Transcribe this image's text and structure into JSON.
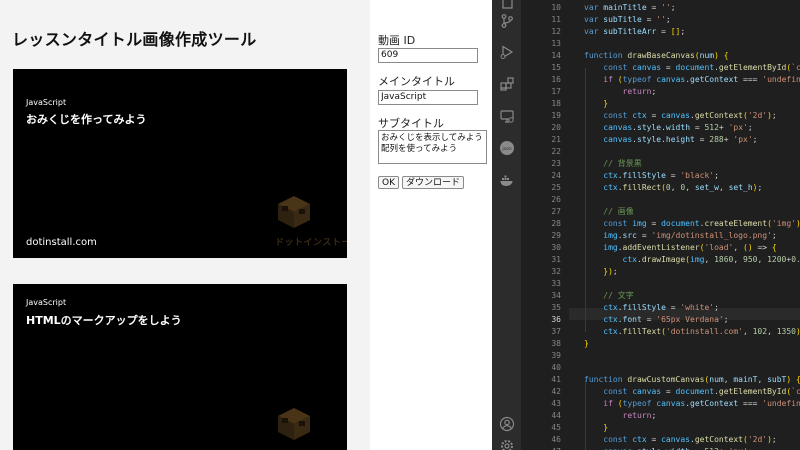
{
  "app": {
    "title": "レッスンタイトル画像作成ツール",
    "canvases": [
      {
        "lang": "JavaScript",
        "main": "おみくじを作ってみよう",
        "site": "dotinstall.com",
        "logo_text": "ドットインストール"
      },
      {
        "lang": "JavaScript",
        "main": "HTMLのマークアップをしよう",
        "site": "",
        "logo_text": ""
      }
    ]
  },
  "form": {
    "video_id_label": "動画 ID",
    "video_id_value": "609",
    "main_title_label": "メインタイトル",
    "main_title_value": "JavaScript",
    "sub_title_label": "サブタイトル",
    "sub_title_lines": [
      "おみくじを表示してみよう",
      "配列を使ってみよう"
    ],
    "ok_label": "OK",
    "download_label": "ダウンロード"
  },
  "editor": {
    "active_line": 36,
    "line_numbers": [
      10,
      11,
      12,
      13,
      14,
      15,
      16,
      17,
      18,
      19,
      20,
      21,
      22,
      23,
      24,
      25,
      26,
      27,
      28,
      29,
      30,
      31,
      32,
      33,
      34,
      35,
      36,
      37,
      38,
      39,
      40,
      41,
      42,
      43,
      44,
      45,
      46,
      47
    ],
    "line_texts": [
      "var mainTitle = '';",
      "var subTitle = '';",
      "var subTitleArr = [];",
      "",
      "function drawBaseCanvas(num) {",
      "    const canvas = document.getElementById(`ca",
      "    if (typeof canvas.getContext === 'undefine",
      "        return;",
      "    }",
      "    const ctx = canvas.getContext('2d');",
      "    canvas.style.width = 512+ 'px';",
      "    canvas.style.height = 288+ 'px';",
      "",
      "    // 背景黒",
      "    ctx.fillStyle = 'black';",
      "    ctx.fillRect(0, 0, set_w, set_h);",
      "",
      "    // 画像",
      "    const img = document.createElement('img');",
      "    img.src = 'img/dotinstall_logo.png';",
      "    img.addEventListener('load', () => {",
      "        ctx.drawImage(img, 1860, 950, 1200+0.5",
      "    });",
      "",
      "    // 文字",
      "    ctx.fillStyle = 'white';",
      "    ctx.font = '65px Verdana';",
      "    ctx.fillText('dotinstall.com', 102, 1350);",
      "}",
      "",
      "",
      "function drawCustomCanvas(num, mainT, subT) {",
      "    const canvas = document.getElementById(`ca",
      "    if (typeof canvas.getContext === 'undefine",
      "        return;",
      "    }",
      "    const ctx = canvas.getContext('2d');",
      "    canvas.style.width = 512+ 'px';"
    ]
  },
  "icons": [
    "explorer-icon",
    "source-control-icon",
    "run-debug-icon",
    "extensions-icon",
    "remote-explorer-icon",
    "json-icon",
    "docker-icon",
    "account-icon",
    "settings-gear-icon"
  ],
  "colors": {
    "editor_bg": "#1f1f1f",
    "activity_bg": "#2c2c2c",
    "keyword": "#569cd6",
    "string": "#ce9178",
    "number": "#b5cea8",
    "comment": "#6a9955"
  }
}
